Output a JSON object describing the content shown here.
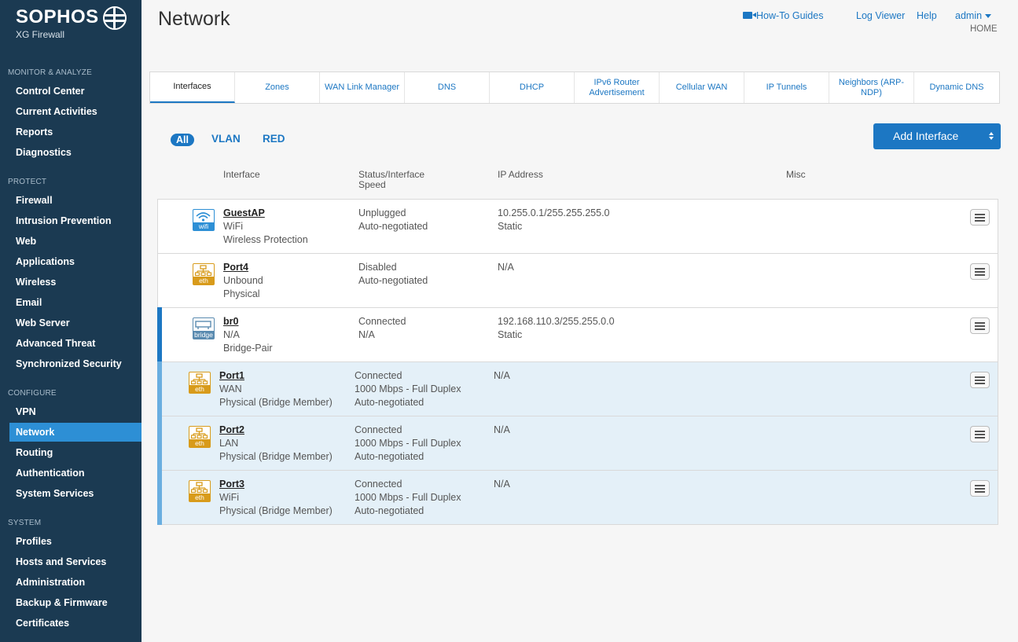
{
  "brand": {
    "name": "SOPHOS",
    "product": "XG Firewall"
  },
  "sidebar": {
    "sections": [
      {
        "title": "MONITOR & ANALYZE",
        "items": [
          "Control Center",
          "Current Activities",
          "Reports",
          "Diagnostics"
        ]
      },
      {
        "title": "PROTECT",
        "items": [
          "Firewall",
          "Intrusion Prevention",
          "Web",
          "Applications",
          "Wireless",
          "Email",
          "Web Server",
          "Advanced Threat",
          "Synchronized Security"
        ]
      },
      {
        "title": "CONFIGURE",
        "items": [
          "VPN",
          "Network",
          "Routing",
          "Authentication",
          "System Services"
        ]
      },
      {
        "title": "SYSTEM",
        "items": [
          "Profiles",
          "Hosts and Services",
          "Administration",
          "Backup & Firmware",
          "Certificates"
        ]
      }
    ],
    "active_item": "Network"
  },
  "header": {
    "title": "Network",
    "howto": "How-To Guides",
    "log_viewer": "Log Viewer",
    "help": "Help",
    "user": "admin",
    "home": "HOME"
  },
  "tabs": [
    "Interfaces",
    "Zones",
    "WAN Link Manager",
    "DNS",
    "DHCP",
    "IPv6 Router Advertisement",
    "Cellular WAN",
    "IP Tunnels",
    "Neighbors (ARP-NDP)",
    "Dynamic DNS"
  ],
  "active_tab": "Interfaces",
  "filters": [
    "All",
    "VLAN",
    "RED"
  ],
  "add_button": "Add Interface",
  "table": {
    "headers": {
      "interface": "Interface",
      "status": "Status/Interface Speed",
      "ip": "IP Address",
      "misc": "Misc"
    },
    "rows": [
      {
        "icon": "wifi",
        "icon_label": "wifi",
        "name": "GuestAP",
        "line2": "WiFi",
        "line3": "Wireless Protection",
        "status1": "Unplugged",
        "status2": "Auto-negotiated",
        "status3": "",
        "ip1": "10.255.0.1/255.255.255.0",
        "ip2": "Static"
      },
      {
        "icon": "eth",
        "icon_label": "eth",
        "name": "Port4",
        "line2": "Unbound",
        "line3": "Physical",
        "status1": "Disabled",
        "status2": "Auto-negotiated",
        "status3": "",
        "ip1": "N/A",
        "ip2": ""
      },
      {
        "icon": "bridge",
        "icon_label": "bridge",
        "name": "br0",
        "line2": "N/A",
        "line3": "Bridge-Pair",
        "status1": "Connected",
        "status2": "N/A",
        "status3": "",
        "ip1": "192.168.110.3/255.255.0.0",
        "ip2": "Static"
      },
      {
        "icon": "eth",
        "icon_label": "eth",
        "name": "Port1",
        "line2": "WAN",
        "line3": "Physical (Bridge Member)",
        "status1": "Connected",
        "status2": "1000 Mbps - Full Duplex",
        "status3": "Auto-negotiated",
        "ip1": "N/A",
        "ip2": ""
      },
      {
        "icon": "eth",
        "icon_label": "eth",
        "name": "Port2",
        "line2": "LAN",
        "line3": "Physical (Bridge Member)",
        "status1": "Connected",
        "status2": "1000 Mbps - Full Duplex",
        "status3": "Auto-negotiated",
        "ip1": "N/A",
        "ip2": ""
      },
      {
        "icon": "eth",
        "icon_label": "eth",
        "name": "Port3",
        "line2": "WiFi",
        "line3": "Physical (Bridge Member)",
        "status1": "Connected",
        "status2": "1000 Mbps - Full Duplex",
        "status3": "Auto-negotiated",
        "ip1": "N/A",
        "ip2": ""
      }
    ]
  },
  "colors": {
    "sidebar": "#1b3a52",
    "accent": "#1c77c3",
    "active_nav": "#2d8fd5",
    "eth_icon": "#d89b1b",
    "member_row": "#e4f0f8"
  }
}
